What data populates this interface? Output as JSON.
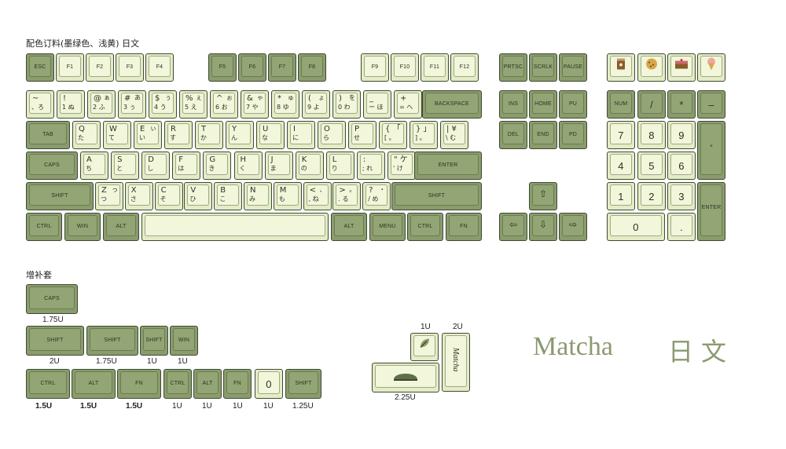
{
  "title": "配色订料(墨绿色、浅黄) 日文",
  "addon_title": "增补套",
  "brand": {
    "name": "Matcha",
    "lang": "日文"
  },
  "colors": {
    "dark": "#8a9c6c",
    "light": "#e3ecc4",
    "text": "#2b3322"
  },
  "fn_row": {
    "esc": "ESC",
    "f1": "F1",
    "f2": "F2",
    "f3": "F3",
    "f4": "F4",
    "f5": "F5",
    "f6": "F6",
    "f7": "F7",
    "f8": "F8",
    "f9": "F9",
    "f10": "F10",
    "f11": "F11",
    "f12": "F12",
    "prtsc": "PRTSC",
    "scrlk": "SCRLK",
    "pause": "PAUSE"
  },
  "row1": [
    {
      "t": "~",
      "b": "、ろ"
    },
    {
      "t": "!",
      "b": "1 ぬ"
    },
    {
      "t": "@",
      "b": "2 ふ",
      "r": "ぁ"
    },
    {
      "t": "#",
      "b": "3 ぅ",
      "r": "あ"
    },
    {
      "t": "$",
      "b": "4 う",
      "r": "ぅ"
    },
    {
      "t": "%",
      "b": "5 え",
      "r": "ぇ"
    },
    {
      "t": "^",
      "b": "6 お",
      "r": "ぉ"
    },
    {
      "t": "&",
      "b": "7 や",
      "r": "ゃ"
    },
    {
      "t": "*",
      "b": "8 ゆ",
      "r": "ゅ"
    },
    {
      "t": "(",
      "b": "9 よ",
      "r": "ょ"
    },
    {
      "t": ")",
      "b": "0 わ",
      "r": "を"
    },
    {
      "t": "_",
      "b": "ー ほ"
    },
    {
      "t": "+",
      "b": "= へ"
    }
  ],
  "backspace": "BACKSPACE",
  "tab": "TAB",
  "row2": [
    {
      "t": "Q",
      "b": "た"
    },
    {
      "t": "W",
      "b": "て"
    },
    {
      "t": "E",
      "b": "い",
      "r": "ぃ"
    },
    {
      "t": "R",
      "b": "す"
    },
    {
      "t": "T",
      "b": "か"
    },
    {
      "t": "Y",
      "b": "ん"
    },
    {
      "t": "U",
      "b": "な"
    },
    {
      "t": "I",
      "b": "に"
    },
    {
      "t": "O",
      "b": "ら"
    },
    {
      "t": "P",
      "b": "せ"
    },
    {
      "t": "{ 「",
      "b": "[ 。"
    },
    {
      "t": "} 」",
      "b": "] 。"
    },
    {
      "t": "| ¥",
      "b": "\\ む"
    }
  ],
  "caps": "CAPS",
  "row3": [
    {
      "t": "A",
      "b": "ち"
    },
    {
      "t": "S",
      "b": "と"
    },
    {
      "t": "D",
      "b": "し"
    },
    {
      "t": "F",
      "b": "は"
    },
    {
      "t": "G",
      "b": "き"
    },
    {
      "t": "H",
      "b": "く"
    },
    {
      "t": "J",
      "b": "ま"
    },
    {
      "t": "K",
      "b": "の"
    },
    {
      "t": "L",
      "b": "り"
    },
    {
      "t": ":",
      "b": "; れ"
    },
    {
      "t": "\" ケ",
      "b": "' け"
    }
  ],
  "enter": "ENTER",
  "shift": "SHIFT",
  "row4": [
    {
      "t": "Z",
      "b": "つ",
      "r": "っ"
    },
    {
      "t": "X",
      "b": "さ"
    },
    {
      "t": "C",
      "b": "そ"
    },
    {
      "t": "V",
      "b": "ひ"
    },
    {
      "t": "B",
      "b": "こ"
    },
    {
      "t": "N",
      "b": "み"
    },
    {
      "t": "M",
      "b": "も"
    },
    {
      "t": "<",
      "b": ", ね",
      "r": "、"
    },
    {
      "t": ">",
      "b": ". る",
      "r": "。"
    },
    {
      "t": "?",
      "b": "/ め",
      "r": "・"
    }
  ],
  "bottom": {
    "ctrl": "CTRL",
    "win": "WIN",
    "alt": "ALT",
    "alt2": "ALT",
    "menu": "MENU",
    "ctrl2": "CTRL",
    "fn": "FN"
  },
  "nav": {
    "ins": "INS",
    "home": "HOME",
    "pu": "PU",
    "del": "DEL",
    "end": "END",
    "pd": "PD"
  },
  "numpad": {
    "num": "NUM",
    "div": "/",
    "mul": "*",
    "minus": "–",
    "plus": "+",
    "enter": "ENTER",
    "n7": "7",
    "n8": "8",
    "n9": "9",
    "n4": "4",
    "n5": "5",
    "n6": "6",
    "n1": "1",
    "n2": "2",
    "n3": "3",
    "n0": "0",
    "dot": "."
  },
  "addon": {
    "caps": "CAPS",
    "caps_size": "1.75U",
    "shift1": "SHIFT",
    "shift1_size": "2U",
    "shift2": "SHIFT",
    "shift2_size": "1.75U",
    "shift3": "SHIFT",
    "shift3_size": "1U",
    "win": "WIN",
    "win_size": "1U",
    "ctrl1": "CTRL",
    "ctrl1_size": "1.5U",
    "alt1": "ALT",
    "alt1_size": "1.5U",
    "fn1": "FN",
    "fn1_size": "1.5U",
    "ctrl2": "CTRL",
    "ctrl2_size": "1U",
    "alt2": "ALT",
    "alt2_size": "1U",
    "fn2": "FN",
    "fn2_size": "1U",
    "zero": "0",
    "zero_size": "1U",
    "shift4": "SHIFT",
    "shift4_size": "1.25U",
    "leaf_size": "1U",
    "matcha_size": "2U",
    "space_size": "2.25U",
    "matcha_key": "Matcha"
  }
}
